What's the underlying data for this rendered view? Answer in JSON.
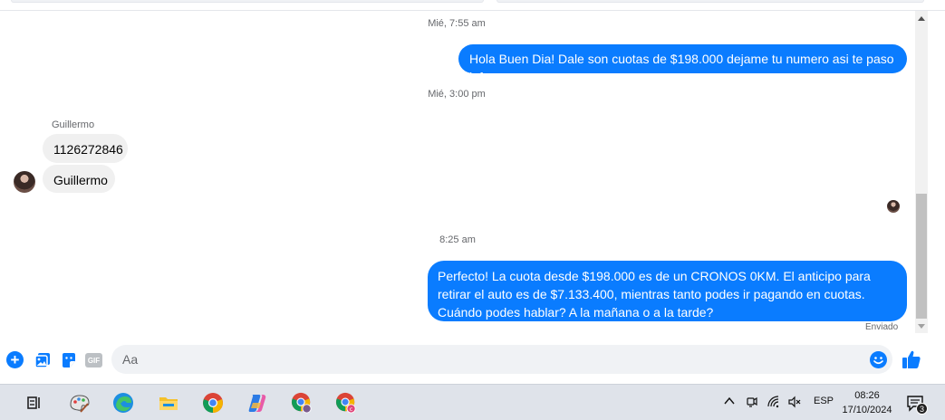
{
  "messages": {
    "ts1": "Mié, 7:55 am",
    "out1": "Hola Buen Dia! Dale son cuotas de $198.000 dejame tu numero asi te paso info.",
    "ts2": "Mié, 3:00 pm",
    "sender_name": "Guillermo",
    "in1": "1126272846",
    "in2": "Guillermo",
    "ts3": "8:25 am",
    "out2": "Perfecto! La cuota desde $198.000 es de un CRONOS 0KM. El anticipo para retirar el auto es de $7.133.400, mientras tanto podes ir pagando en cuotas. Cuándo podes hablar? A la mañana o a la tarde?",
    "status": "Enviado"
  },
  "composer": {
    "placeholder": "Aa",
    "gif_label": "GIF",
    "add_icon": "plus-circle-icon",
    "image_icon": "image-icon",
    "sticker_icon": "sticker-icon",
    "emoji_icon": "emoji-icon",
    "like_icon": "thumbs-up-icon"
  },
  "taskbar": {
    "items": [
      "task-view-icon",
      "paint-icon",
      "edge-icon",
      "file-explorer-icon",
      "chrome-icon",
      "copilot-icon",
      "chrome-profile-icon",
      "chrome-profile-c-icon"
    ],
    "language": "ESP",
    "time": "08:26",
    "date": "17/10/2024",
    "notification_count": "3",
    "profile_badge": "c"
  },
  "colors": {
    "outgoing_bubble": "#0a7cff",
    "incoming_bubble": "#f0f0f0",
    "taskbar": "#dfe3ea"
  }
}
